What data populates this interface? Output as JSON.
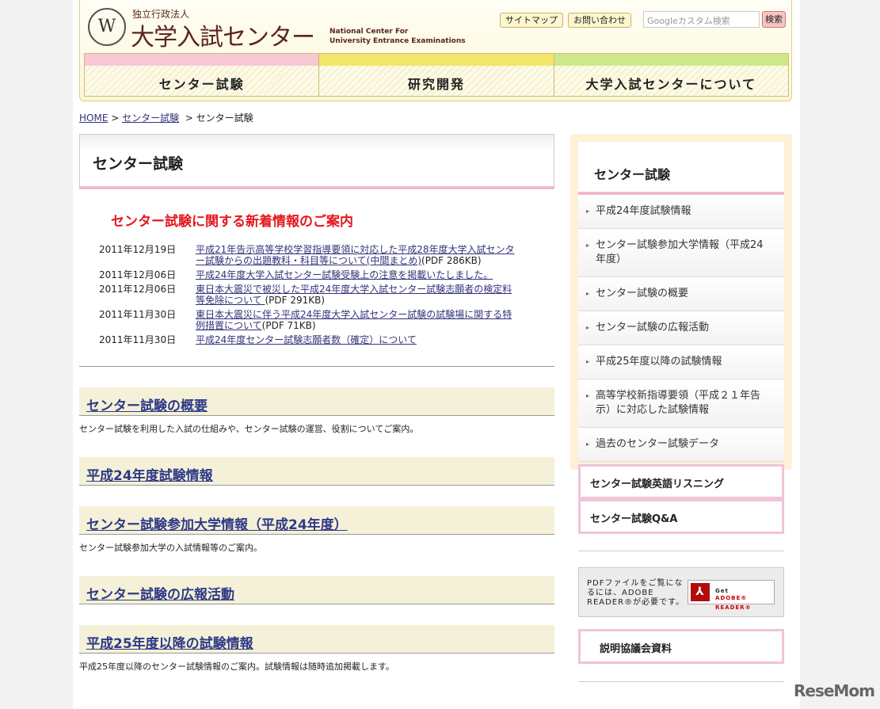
{
  "header": {
    "logo_sub": "独立行政法人",
    "logo_main": "大学入試センター",
    "logo_en_1": "National Center For",
    "logo_en_2": "University Entrance Examinations",
    "sitemap": "サイトマップ",
    "contact": "お問い合わせ",
    "search_placeholder": "Googleカスタム検索",
    "search_button": "検索"
  },
  "nav": [
    {
      "label": "センター試験",
      "color": "#f8c8d4"
    },
    {
      "label": "研究開発",
      "color": "#f3e46a"
    },
    {
      "label": "大学入試センターについて",
      "color": "#cfe88a"
    }
  ],
  "breadcrumb": {
    "home": "HOME",
    "sep": " > ",
    "parent": "センター試験",
    "current": "センター試験"
  },
  "main": {
    "title": "センター試験",
    "news_heading": "センター試験に関する新着情報のご案内",
    "news": [
      {
        "date": "2011年12月19日",
        "link": "平成21年告示高等学校学習指導要領に対応した平成28年度大学入試センター試験からの出題教科・科目等について(中間まとめ)",
        "note": "(PDF 286KB)"
      },
      {
        "date": "2011年12月06日",
        "link": "平成24年度大学入試センター試験受験上の注意を掲載いたしました。",
        "note": ""
      },
      {
        "date": "2011年12月06日",
        "link": "東日本大震災で被災した平成24年度大学入試センター試験志願者の検定料等免除について ",
        "note": "(PDF 291KB)"
      },
      {
        "date": "2011年11月30日",
        "link": "東日本大震災に伴う平成24年度大学入試センター試験の試験場に関する特例措置について",
        "note": "(PDF 71KB)"
      },
      {
        "date": "2011年11月30日",
        "link": "平成24年度センター試験志願者数（確定）について",
        "note": ""
      }
    ],
    "sections": [
      {
        "title": "センター試験の概要",
        "desc": "センター試験を利用した入試の仕組みや、センター試験の運営、役割についてご案内。"
      },
      {
        "title": "平成24年度試験情報",
        "desc": ""
      },
      {
        "title": "センター試験参加大学情報（平成24年度）",
        "desc": "センター試験参加大学の入試情報等のご案内。"
      },
      {
        "title": "センター試験の広報活動",
        "desc": ""
      },
      {
        "title": "平成25年度以降の試験情報",
        "desc": "平成25年度以降のセンター試験情報のご案内。試験情報は随時追加掲載します。"
      }
    ]
  },
  "sidebar": {
    "title": "センター試験",
    "items": [
      "平成24年度試験情報",
      "センター試験参加大学情報（平成24年度）",
      "センター試験の概要",
      "センター試験の広報活動",
      "平成25年度以降の試験情報",
      "高等学校新指導要領（平成２１年告示）に対応した試験情報",
      "過去のセンター試験データ"
    ],
    "listening": "センター試験英語リスニング",
    "qa": "センター試験Q&A",
    "pdf_note": "PDFファイルをご覧になるには、ADOBE READER®が必要です。",
    "adobe_get": "Get",
    "adobe_reader": "ADOBE® READER®",
    "briefing": "説明協議会資料"
  },
  "watermark": "ReseMom"
}
